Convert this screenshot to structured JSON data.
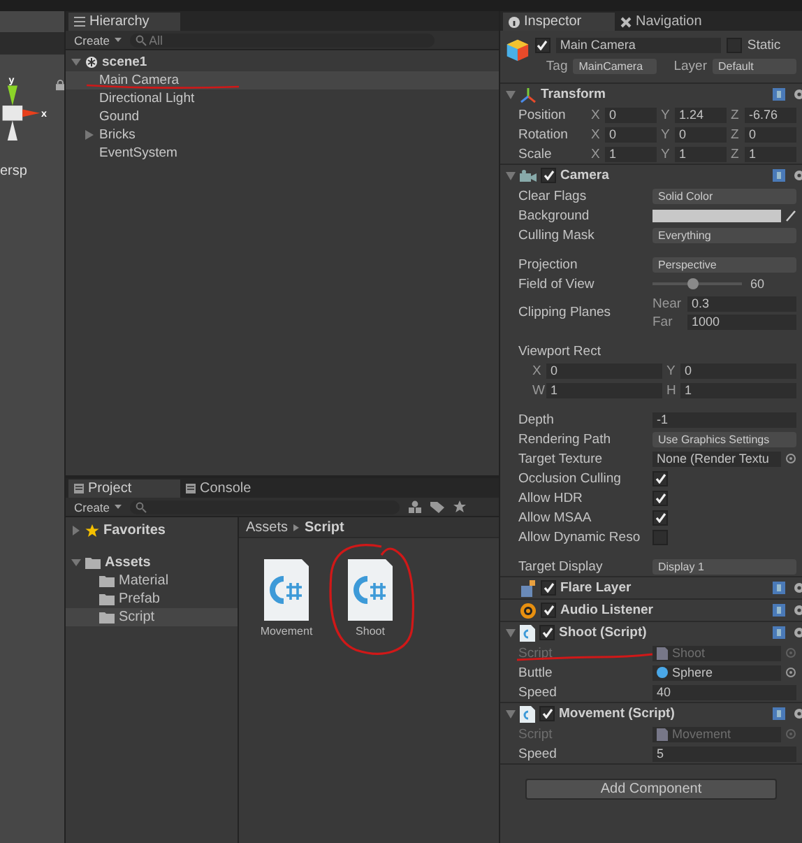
{
  "scene_view": {
    "axes": [
      "y",
      "x"
    ],
    "label": "ersp"
  },
  "hierarchy": {
    "tab": "Hierarchy",
    "create": "Create",
    "search_placeholder": "All",
    "scene": "scene1",
    "scene_expanded": true,
    "items": [
      {
        "label": "Main Camera",
        "selected": true,
        "has_children": false,
        "annotated": true
      },
      {
        "label": "Directional Light",
        "selected": false,
        "has_children": false,
        "annotated": false
      },
      {
        "label": "Gound",
        "selected": false,
        "has_children": false,
        "annotated": false
      },
      {
        "label": "Bricks",
        "selected": false,
        "has_children": true,
        "annotated": false
      },
      {
        "label": "EventSystem",
        "selected": false,
        "has_children": false,
        "annotated": false
      }
    ]
  },
  "project": {
    "tabs": [
      {
        "label": "Project",
        "selected": true
      },
      {
        "label": "Console",
        "selected": false
      }
    ],
    "create": "Create",
    "tree": [
      {
        "label": "Favorites",
        "kind": "favorites",
        "expanded": false
      },
      {
        "label": "Assets",
        "kind": "folder",
        "expanded": true,
        "children": [
          {
            "label": "Material",
            "selected": false
          },
          {
            "label": "Prefab",
            "selected": false
          },
          {
            "label": "Script",
            "selected": true
          }
        ]
      }
    ],
    "breadcrumb": [
      "Assets",
      "Script"
    ],
    "files": [
      {
        "name": "Movement",
        "annotated": false
      },
      {
        "name": "Shoot",
        "annotated": true
      }
    ]
  },
  "inspector": {
    "tabs": [
      {
        "label": "Inspector",
        "selected": true
      },
      {
        "label": "Navigation",
        "selected": false
      }
    ],
    "object": {
      "active": true,
      "name": "Main Camera",
      "static_label": "Static",
      "static": false,
      "tag_label": "Tag",
      "tag": "MainCamera",
      "layer_label": "Layer",
      "layer": "Default"
    },
    "components": [
      {
        "kind": "transform",
        "title": "Transform",
        "fields": [
          {
            "kind": "vector3",
            "label": "Position",
            "values": [
              {
                "axis": "X",
                "value": "0"
              },
              {
                "axis": "Y",
                "value": "1.24"
              },
              {
                "axis": "Z",
                "value": "-6.76"
              }
            ]
          },
          {
            "kind": "vector3",
            "label": "Rotation",
            "values": [
              {
                "axis": "X",
                "value": "0"
              },
              {
                "axis": "Y",
                "value": "0"
              },
              {
                "axis": "Z",
                "value": "0"
              }
            ]
          },
          {
            "kind": "vector3",
            "label": "Scale",
            "values": [
              {
                "axis": "X",
                "value": "1"
              },
              {
                "axis": "Y",
                "value": "1"
              },
              {
                "axis": "Z",
                "value": "1"
              }
            ]
          }
        ]
      },
      {
        "kind": "camera",
        "title": "Camera",
        "enabled": true,
        "fields": [
          {
            "kind": "dropdown",
            "label": "Clear Flags",
            "value": "Solid Color"
          },
          {
            "kind": "color",
            "label": "Background"
          },
          {
            "kind": "dropdown",
            "label": "Culling Mask",
            "value": "Everything"
          },
          {
            "kind": "dropdown",
            "label": "Projection",
            "value": "Perspective",
            "gap_before": true
          },
          {
            "kind": "slider",
            "label": "Field of View",
            "level": 0.45,
            "value": "60"
          },
          {
            "kind": "pair",
            "label": "Clipping Planes",
            "values": [
              {
                "axis": "Near",
                "value": "0.3"
              },
              {
                "axis": "Far",
                "value": "1000"
              }
            ]
          },
          {
            "kind": "header",
            "label": "Viewport Rect",
            "gap_before": true
          },
          {
            "kind": "xy",
            "values": [
              {
                "axis": "X",
                "value": "0"
              },
              {
                "axis": "Y",
                "value": "0"
              }
            ]
          },
          {
            "kind": "xy",
            "values": [
              {
                "axis": "W",
                "value": "1"
              },
              {
                "axis": "H",
                "value": "1"
              }
            ]
          },
          {
            "kind": "number",
            "label": "Depth",
            "value": "-1",
            "gap_before": true
          },
          {
            "kind": "dropdown",
            "label": "Rendering Path",
            "value": "Use Graphics Settings"
          },
          {
            "kind": "object",
            "label": "Target Texture",
            "value": "None (Render Textu",
            "disabled": false
          },
          {
            "kind": "checkbox",
            "label": "Occlusion Culling",
            "checked": true
          },
          {
            "kind": "checkbox",
            "label": "Allow HDR",
            "checked": true
          },
          {
            "kind": "checkbox",
            "label": "Allow MSAA",
            "checked": true
          },
          {
            "kind": "checkbox",
            "label": "Allow Dynamic Reso",
            "checked": false
          },
          {
            "kind": "dropdown",
            "label": "Target Display",
            "value": "Display 1",
            "gap_before": true
          }
        ]
      },
      {
        "kind": "flare",
        "title": "Flare Layer",
        "enabled": true
      },
      {
        "kind": "audio",
        "title": "Audio Listener",
        "enabled": true
      },
      {
        "kind": "script",
        "title": "Shoot (Script)",
        "enabled": true,
        "fields": [
          {
            "kind": "script_ref",
            "label": "Script",
            "value": "Shoot",
            "disabled": true,
            "annotated": true
          },
          {
            "kind": "prefab_ref",
            "label": "Buttle",
            "value": "Sphere",
            "disabled": false
          },
          {
            "kind": "number",
            "label": "Speed",
            "value": "40"
          }
        ]
      },
      {
        "kind": "script",
        "title": "Movement (Script)",
        "enabled": true,
        "fields": [
          {
            "kind": "script_ref",
            "label": "Script",
            "value": "Movement",
            "disabled": true
          },
          {
            "kind": "number",
            "label": "Speed",
            "value": "5"
          }
        ]
      }
    ],
    "add_button": "Add Component"
  }
}
